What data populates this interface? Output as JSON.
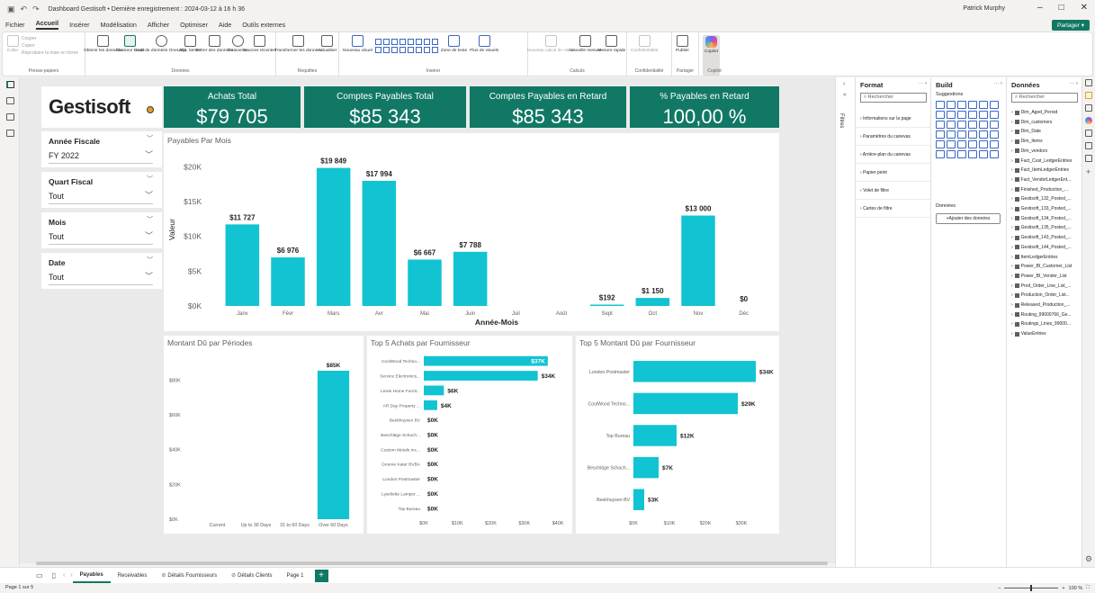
{
  "titlebar": {
    "title": "Dashboard Gestisoft • Dernière enregistrement : 2024-03-12 à 16 h 36",
    "user": "Patrick Murphy"
  },
  "menu": [
    "Fichier",
    "Accueil",
    "Insérer",
    "Modélisation",
    "Afficher",
    "Optimiser",
    "Aide",
    "Outils externes"
  ],
  "share_label": "Partager",
  "ribbon": {
    "clipboard": {
      "name": "Presse-papiers",
      "paste": "Coller",
      "cut": "Couper",
      "copy": "Copier",
      "format": "Reproduire la mise en forme"
    },
    "data": {
      "name": "Données",
      "items": [
        "Obtenir les données",
        "Classeur Excel",
        "Hub de données OneLake",
        "SQL Server",
        "Entrer des données",
        "Dataverse",
        "Sources récentes"
      ]
    },
    "queries": {
      "name": "Requêtes",
      "items": [
        "Transformer les données",
        "Actualiser"
      ]
    },
    "insert": {
      "name": "Insérer",
      "items": [
        "Nouveau visuel",
        "Zone de texte",
        "Plus de visuels"
      ]
    },
    "calc": {
      "name": "Calculs",
      "items": [
        "Nouveau calcul de visuel",
        "Nouvelle mesure",
        "Mesure rapide"
      ]
    },
    "sensitivity": {
      "name": "Confidentialité",
      "items": [
        "Confidentialité"
      ]
    },
    "share": {
      "name": "Partager",
      "items": [
        "Publier"
      ]
    },
    "copilot": {
      "name": "Copilot",
      "items": [
        "Copilot"
      ]
    }
  },
  "logo_text": "Gestisoft",
  "kpis": [
    {
      "title": "Achats Total",
      "value": "$79 705"
    },
    {
      "title": "Comptes Payables Total",
      "value": "$85 343"
    },
    {
      "title": "Comptes Payables en Retard",
      "value": "$85 343"
    },
    {
      "title": "% Payables en Retard",
      "value": "100,00 %"
    }
  ],
  "slicers": [
    {
      "title": "Année Fiscale",
      "value": "FY 2022"
    },
    {
      "title": "Quart Fiscal",
      "value": "Tout"
    },
    {
      "title": "Mois",
      "value": "Tout"
    },
    {
      "title": "Date",
      "value": "Tout"
    }
  ],
  "chart_data": [
    {
      "id": "payables-par-mois",
      "type": "bar",
      "title": "Payables Par Mois",
      "xlabel": "Année-Mois",
      "ylabel": "Valeur",
      "categories": [
        "Janv",
        "Févr",
        "Mars",
        "Avr",
        "Mai",
        "Juin",
        "Juil",
        "Août",
        "Sept",
        "Oct",
        "Nov",
        "Déc"
      ],
      "values": [
        11727,
        6976,
        19849,
        17994,
        6667,
        7788,
        null,
        null,
        192,
        1150,
        13000,
        0
      ],
      "data_labels": [
        "$11 727",
        "$6 976",
        "$19 849",
        "$17 994",
        "$6 667",
        "$7 788",
        "",
        "",
        "$192",
        "$1 150",
        "$13 000",
        "$0"
      ],
      "yticks": [
        "$0K",
        "$5K",
        "$10K",
        "$15K",
        "$20K"
      ],
      "ylim": [
        0,
        22000
      ],
      "color": "#12c3d2"
    },
    {
      "id": "montant-du-periodes",
      "type": "bar",
      "title": "Montant Dû par Périodes",
      "categories": [
        "Current",
        "Up to 30 Days",
        "31 to 60 Days",
        "Over 60 Days"
      ],
      "values": [
        0,
        0,
        0,
        85343
      ],
      "data_labels": [
        "",
        "",
        "",
        "$85K"
      ],
      "yticks": [
        "$0K",
        "$20K",
        "$40K",
        "$60K",
        "$80K"
      ],
      "ylim": [
        0,
        90000
      ],
      "color": "#12c3d2"
    },
    {
      "id": "top5-achats",
      "type": "bar",
      "orientation": "horizontal",
      "title": "Top 5 Achats par Fournisseur",
      "categories": [
        "CoolWood Techno...",
        "Service Electronics...",
        "Lewis Home Furnit...",
        "AR Day Property ...",
        "Beekhuysen BV",
        "Beschläge Schach...",
        "Custom Metals Inc...",
        "Groene Kater BVBA",
        "London Postmaster",
        "Lyseliette Lamper ...",
        "Top Bureau"
      ],
      "values": [
        37000,
        34000,
        6000,
        4000,
        0,
        0,
        0,
        0,
        0,
        0,
        0
      ],
      "data_labels": [
        "$37K",
        "$34K",
        "$6K",
        "$4K",
        "$0K",
        "$0K",
        "$0K",
        "$0K",
        "$0K",
        "$0K",
        "$0K"
      ],
      "xticks": [
        "$0K",
        "$10K",
        "$20K",
        "$30K",
        "$40K"
      ],
      "xlim": [
        0,
        40000
      ],
      "color": "#12c3d2"
    },
    {
      "id": "top5-montant-du",
      "type": "bar",
      "orientation": "horizontal",
      "title": "Top 5 Montant Dû par Fournisseur",
      "categories": [
        "London Postmaster",
        "CoolWood Techno...",
        "Top Bureau",
        "Beschläge Schach...",
        "Beekhuysen BV"
      ],
      "values": [
        34000,
        29000,
        12000,
        7000,
        3000
      ],
      "data_labels": [
        "$34K",
        "$29K",
        "$12K",
        "$7K",
        "$3K"
      ],
      "xticks": [
        "$0K",
        "$10K",
        "$20K",
        "$30K"
      ],
      "xlim": [
        0,
        35000
      ],
      "color": "#12c3d2"
    }
  ],
  "panes": {
    "format": {
      "title": "Format",
      "search": "Rechercher",
      "sections": [
        "Informations sur la page",
        "Paramètres du canevas",
        "Arrière-plan du canevas",
        "Papier peint",
        "Volet de filtre",
        "Cartes de filtre"
      ],
      "filters_label": "Filtres"
    },
    "build": {
      "title": "Build",
      "suggestions": "Suggestions",
      "data_label": "Données",
      "add_data": "+Ajouter des données"
    },
    "data": {
      "title": "Données",
      "search": "Rechercher",
      "tables": [
        "Dim_Aged_Period",
        "Dim_customers",
        "Dim_Date",
        "Dim_Items",
        "Dim_vendors",
        "Fact_Cust_LedgerEntries",
        "Fact_ItemLedgerEntries",
        "Fact_VendorLedgerEnt...",
        "Finished_Production_...",
        "Gestisoft_132_Posted_...",
        "Gestisoft_133_Posted_...",
        "Gestisoft_134_Posted_...",
        "Gestisoft_135_Posted_...",
        "Gestisoft_143_Posted_...",
        "Gestisoft_144_Posted_...",
        "ItemLedgerEntries",
        "Power_BI_Customer_List",
        "Power_BI_Vendor_List",
        "Prod_Order_Line_List_...",
        "Production_Order_List...",
        "Released_Production_...",
        "Routing_99000766_Ge...",
        "Routings_Lines_99000...",
        "ValueEntries"
      ]
    }
  },
  "page_tabs": [
    "Payables",
    "Receivables",
    "Détails Fournisseurs",
    "Détails Clients",
    "Page 1"
  ],
  "active_tab": "Payables",
  "status": {
    "page": "Page 1 sur 5",
    "zoom": "100 %"
  }
}
